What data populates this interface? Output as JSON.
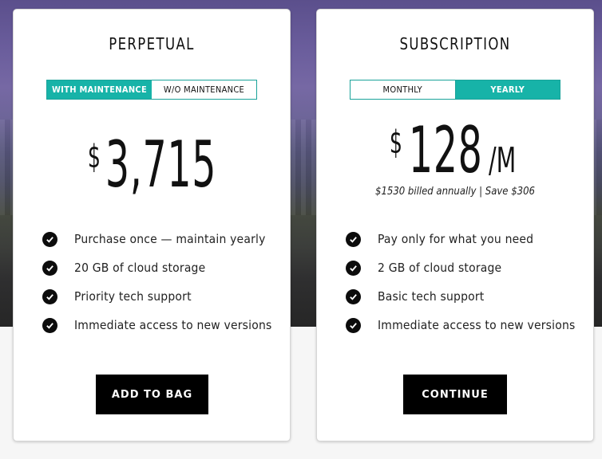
{
  "colors": {
    "accent": "#17b3a8",
    "cta_bg": "#000000",
    "check_bg": "#0c0c0c"
  },
  "perpetual": {
    "title": "PERPETUAL",
    "toggle": [
      "WITH MAINTENANCE",
      "W/O MAINTENANCE"
    ],
    "toggle_selected": "WITH MAINTENANCE",
    "currency": "$",
    "amount": "3,715",
    "features": [
      "Purchase once — maintain yearly",
      "20 GB of cloud storage",
      "Priority tech support",
      "Immediate access to new versions"
    ],
    "cta": "ADD TO BAG"
  },
  "subscription": {
    "title": "SUBSCRIPTION",
    "toggle": [
      "MONTHLY",
      "YEARLY"
    ],
    "toggle_selected": "YEARLY",
    "currency": "$",
    "amount": "128",
    "per": "/M",
    "billing_note": "$1530 billed annually | Save $306",
    "features": [
      "Pay only for what you need",
      "2 GB of cloud storage",
      "Basic tech support",
      "Immediate access to new versions"
    ],
    "cta": "CONTINUE"
  }
}
